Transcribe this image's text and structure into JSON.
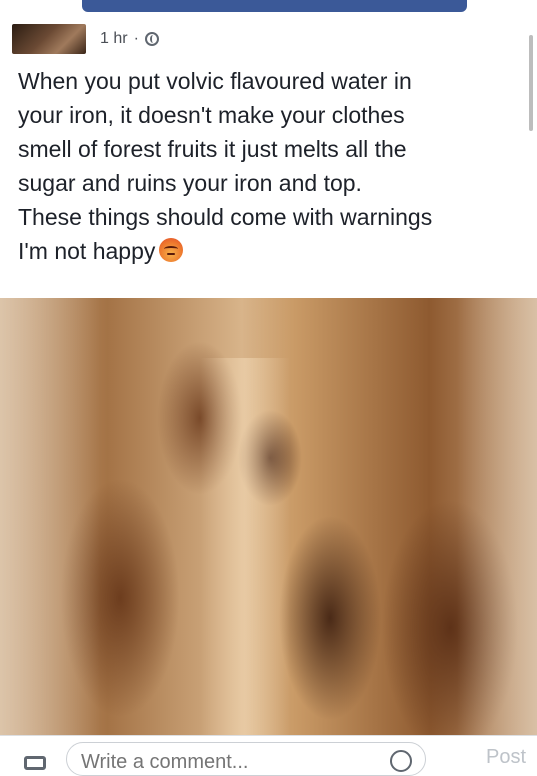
{
  "post": {
    "timestamp": "1 hr",
    "separator": "·",
    "privacy_icon": "globe-icon",
    "text": "When you put volvic flavoured water in\nyour iron, it doesn't make your clothes\nsmell of forest fruits it just melts all the\nsugar and ruins your iron and top.\nThese things should come with warnings\nI'm not happy",
    "emoji": "angry-face-icon"
  },
  "comment_bar": {
    "camera_icon": "camera-icon",
    "placeholder": "Write a comment...",
    "emoji_icon": "smiley-icon",
    "post_label": "Post"
  },
  "colors": {
    "facebook_blue": "#3b5998",
    "text": "#1d2129",
    "meta": "#4b4f56"
  }
}
